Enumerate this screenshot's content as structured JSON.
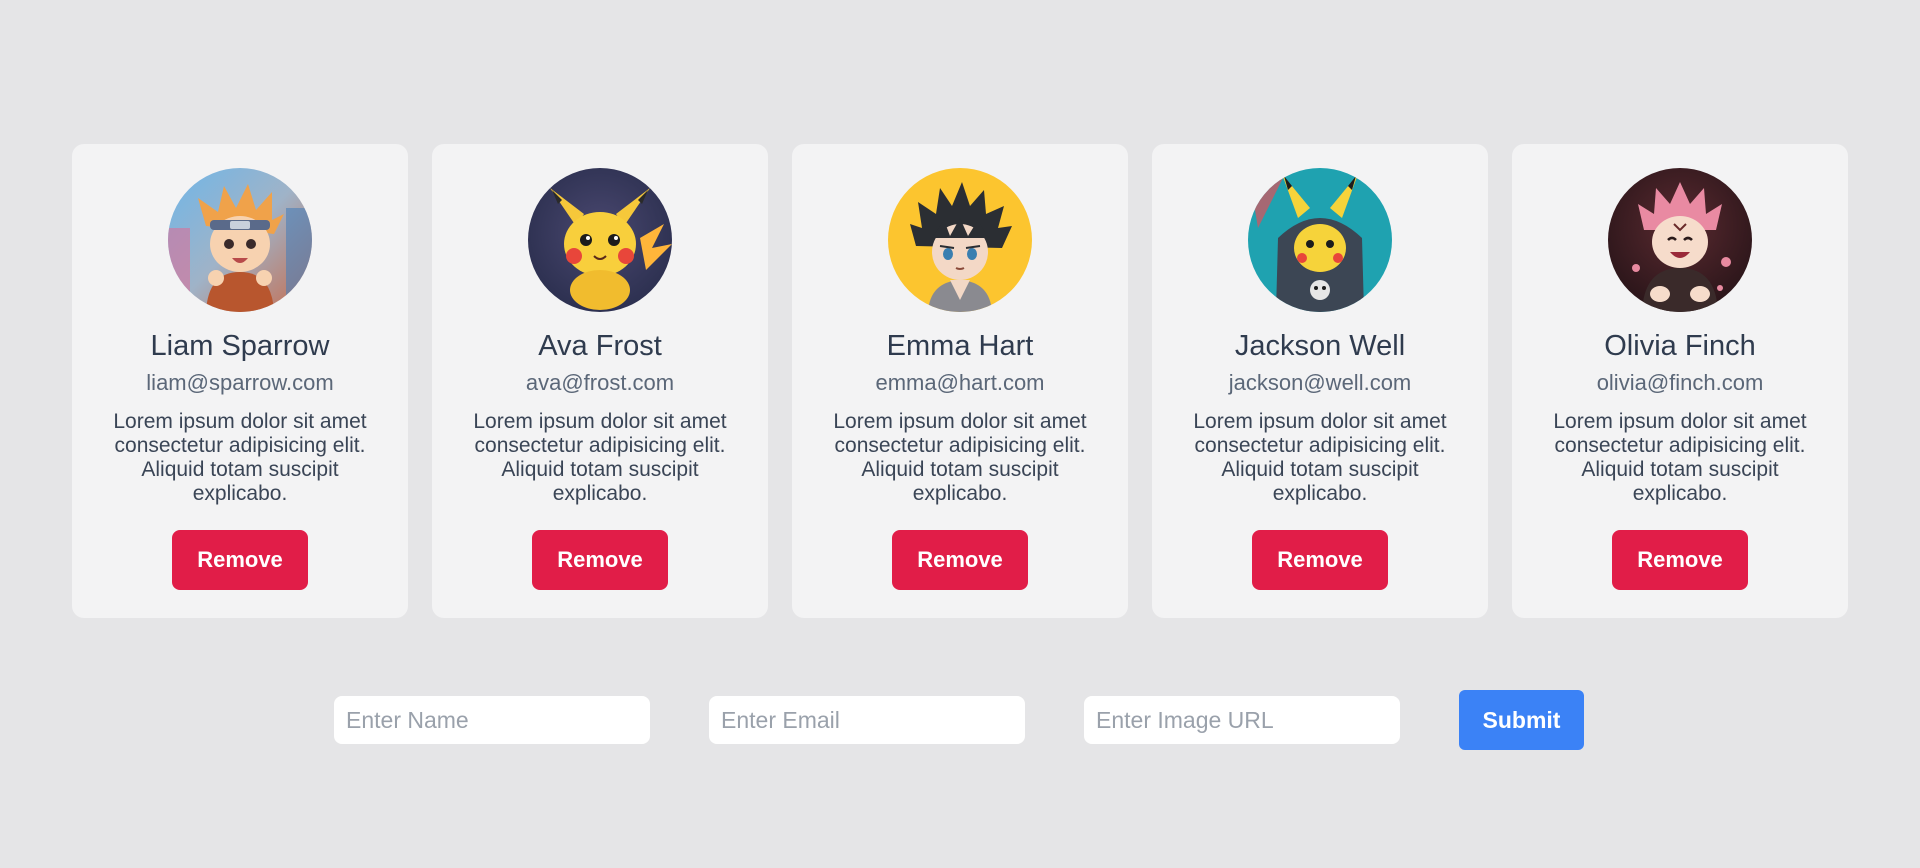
{
  "colors": {
    "page_background": "#e5e5e7",
    "card_background": "#f3f3f4",
    "remove_button": "#e11d48",
    "submit_button": "#3b82f6"
  },
  "cards": [
    {
      "name": "Liam Sparrow",
      "email": "liam@sparrow.com",
      "description": "Lorem ipsum dolor sit amet consectetur adipisicing elit. Aliquid totam suscipit explicabo.",
      "remove_label": "Remove",
      "avatar_icon": "chibi-ninja-avatar"
    },
    {
      "name": "Ava Frost",
      "email": "ava@frost.com",
      "description": "Lorem ipsum dolor sit amet consectetur adipisicing elit. Aliquid totam suscipit explicabo.",
      "remove_label": "Remove",
      "avatar_icon": "electric-mouse-avatar"
    },
    {
      "name": "Emma Hart",
      "email": "emma@hart.com",
      "description": "Lorem ipsum dolor sit amet consectetur adipisicing elit. Aliquid totam suscipit explicabo.",
      "remove_label": "Remove",
      "avatar_icon": "spiky-hair-boy-avatar"
    },
    {
      "name": "Jackson Well",
      "email": "jackson@well.com",
      "description": "Lorem ipsum dolor sit amet consectetur adipisicing elit. Aliquid totam suscipit explicabo.",
      "remove_label": "Remove",
      "avatar_icon": "hooded-electric-mouse-avatar"
    },
    {
      "name": "Olivia Finch",
      "email": "olivia@finch.com",
      "description": "Lorem ipsum dolor sit amet consectetur adipisicing elit. Aliquid totam suscipit explicabo.",
      "remove_label": "Remove",
      "avatar_icon": "pink-hair-chibi-avatar"
    }
  ],
  "form": {
    "name_placeholder": "Enter Name",
    "email_placeholder": "Enter Email",
    "image_placeholder": "Enter Image URL",
    "name_value": "",
    "email_value": "",
    "image_value": "",
    "submit_label": "Submit"
  }
}
